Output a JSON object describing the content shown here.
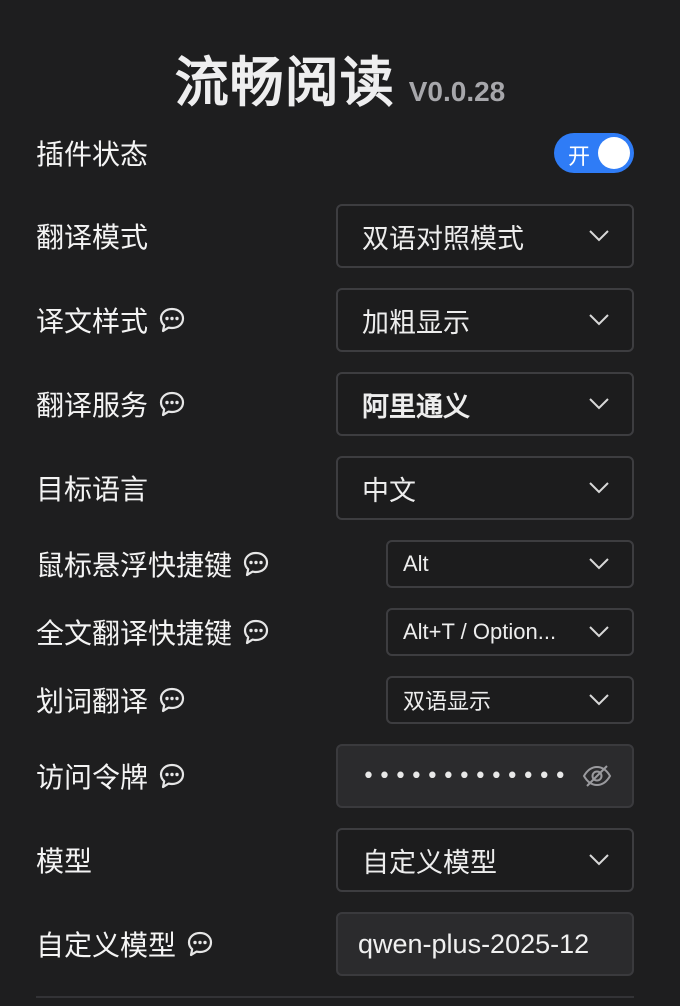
{
  "header": {
    "title": "流畅阅读",
    "version": "V0.0.28"
  },
  "plugin_status": {
    "label": "插件状态",
    "toggle_text": "开",
    "enabled": true,
    "toggle_color": "#2f7cf6"
  },
  "settings": {
    "translate_mode": {
      "label": "翻译模式",
      "value": "双语对照模式"
    },
    "translation_style": {
      "label": "译文样式",
      "value": "加粗显示",
      "icon": "chat-bubble-icon"
    },
    "translate_service": {
      "label": "翻译服务",
      "value": "阿里通义",
      "icon": "chat-bubble-icon"
    },
    "target_language": {
      "label": "目标语言",
      "value": "中文"
    },
    "hover_hotkey": {
      "label": "鼠标悬浮快捷键",
      "value": "Alt",
      "icon": "chat-bubble-icon"
    },
    "fulltext_hotkey": {
      "label": "全文翻译快捷键",
      "value": "Alt+T / Option...",
      "icon": "chat-bubble-icon"
    },
    "selection_translate": {
      "label": "划词翻译",
      "value": "双语显示",
      "icon": "chat-bubble-icon"
    },
    "access_token": {
      "label": "访问令牌",
      "masked_value": "••••••••••••••••",
      "icon": "chat-bubble-icon",
      "action_icon": "eye-off-icon"
    },
    "model": {
      "label": "模型",
      "value": "自定义模型"
    },
    "custom_model": {
      "label": "自定义模型",
      "value": "qwen-plus-2025-12",
      "icon": "chat-bubble-icon"
    }
  },
  "colors": {
    "background": "#1e1e1f",
    "accent": "#2f7cf6"
  }
}
